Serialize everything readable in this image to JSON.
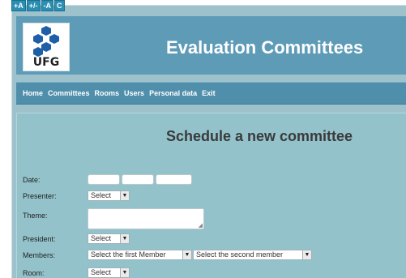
{
  "accessibility": {
    "buttons": [
      "+A",
      "+/-",
      "-A",
      "C"
    ]
  },
  "header": {
    "logo_text": "UFG",
    "title": "Evaluation Committees"
  },
  "nav": {
    "items": [
      "Home",
      "Committees",
      "Rooms",
      "Users",
      "Personal data",
      "Exit"
    ]
  },
  "form": {
    "title": "Schedule a new committee",
    "labels": {
      "date": "Date:",
      "presenter": "Presenter:",
      "theme": "Theme:",
      "president": "President:",
      "members": "Members:",
      "room": "Room:"
    },
    "presenter_select": "Select",
    "president_select": "Select",
    "member1_select": "Select the first Member",
    "member2_select": "Select the second member",
    "room_select": "Select"
  },
  "colors": {
    "header_bg": "#5e9bb7",
    "nav_bg": "#4f8fab",
    "content_bg": "#93c2cb",
    "access_bg": "#2b8fb4"
  },
  "icons": {
    "logo": "ufg-hexagon-logo",
    "dropdown": "dropdown-arrow-icon",
    "resize": "resize-grip-icon"
  }
}
